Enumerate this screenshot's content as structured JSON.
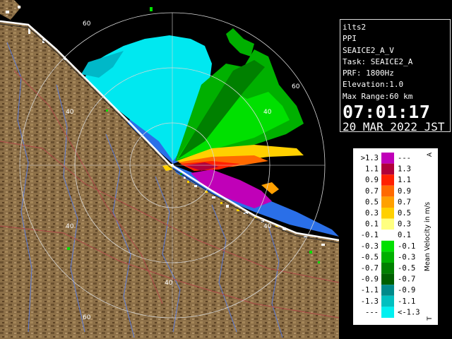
{
  "info": {
    "site": "ilts2",
    "product": "PPI",
    "scan": "SEAICE2_A_V",
    "task": "Task: SEAICE2_A",
    "prf": "PRF: 1800Hz",
    "elevation": "Elevation:1.0",
    "max_range": "Max Range:60 km",
    "time": "07:01:17",
    "date": "20 MAR 2022 JST"
  },
  "range_ring_labels": [
    "60",
    "60",
    "40",
    "40",
    "40",
    "40",
    "40",
    "60"
  ],
  "legend": {
    "title": "Mean Velocity in m/s",
    "top_marker": "A",
    "bottom_marker": "T",
    "rows": [
      {
        "left": ">1.3",
        "right": "---",
        "color": "#c000b8"
      },
      {
        "left": "1.1",
        "right": "1.3",
        "color": "#b0003a"
      },
      {
        "left": "0.9",
        "right": "1.1",
        "color": "#ff2000"
      },
      {
        "left": "0.7",
        "right": "0.9",
        "color": "#ff6a00"
      },
      {
        "left": "0.5",
        "right": "0.7",
        "color": "#ffa000"
      },
      {
        "left": "0.3",
        "right": "0.5",
        "color": "#ffd000"
      },
      {
        "left": "0.1",
        "right": "0.3",
        "color": "#ffff80"
      },
      {
        "left": "-0.1",
        "right": "0.1",
        "color": "#ffffff"
      },
      {
        "left": "-0.3",
        "right": "-0.1",
        "color": "#00e000"
      },
      {
        "left": "-0.5",
        "right": "-0.3",
        "color": "#00b000"
      },
      {
        "left": "-0.7",
        "right": "-0.5",
        "color": "#008000"
      },
      {
        "left": "-0.9",
        "right": "-0.7",
        "color": "#006000"
      },
      {
        "left": "-1.1",
        "right": "-0.9",
        "color": "#008a8a"
      },
      {
        "left": "-1.3",
        "right": "-1.1",
        "color": "#00c0c0"
      },
      {
        "left": "---",
        "right": "<-1.3",
        "color": "#00f0f0"
      }
    ]
  },
  "colors": {
    "land": "#8a6e45",
    "land_dark": "#5e4526",
    "clear_air": "#2a6fe8",
    "sea_ice_cyan": "#00e8f0",
    "ring": "#d8d8d8"
  }
}
